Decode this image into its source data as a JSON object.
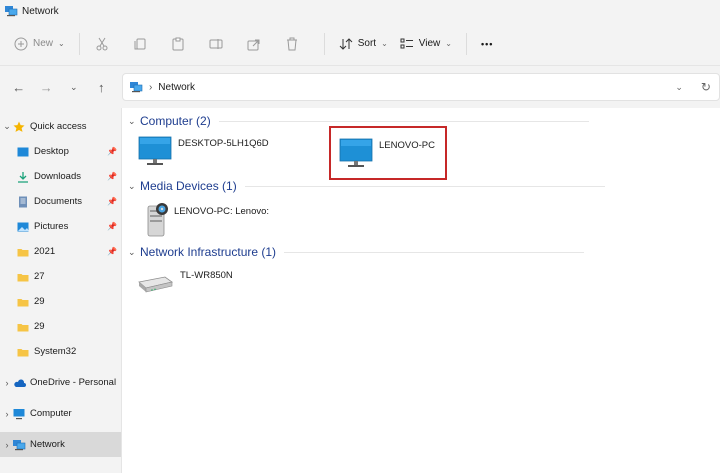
{
  "window": {
    "title": "Network"
  },
  "toolbar": {
    "new_label": "New",
    "sort_label": "Sort",
    "view_label": "View",
    "more_label": "•••"
  },
  "address": {
    "crumb": "Network"
  },
  "sidebar": {
    "quick_access": "Quick access",
    "items": [
      {
        "label": "Desktop"
      },
      {
        "label": "Downloads"
      },
      {
        "label": "Documents"
      },
      {
        "label": "Pictures"
      },
      {
        "label": "2021"
      },
      {
        "label": "27"
      },
      {
        "label": "29"
      },
      {
        "label": "29"
      },
      {
        "label": "System32"
      }
    ],
    "onedrive": "OneDrive - Personal",
    "computer": "Computer",
    "network": "Network"
  },
  "groups": {
    "computer": {
      "label": "Computer (2)"
    },
    "media": {
      "label": "Media Devices (1)"
    },
    "infra": {
      "label": "Network Infrastructure (1)"
    }
  },
  "items": {
    "desktop_pc": "DESKTOP-5LH1Q6D",
    "lenovo_pc": "LENOVO-PC",
    "media_device": "LENOVO-PC: Lenovo:",
    "router": "TL-WR850N"
  }
}
